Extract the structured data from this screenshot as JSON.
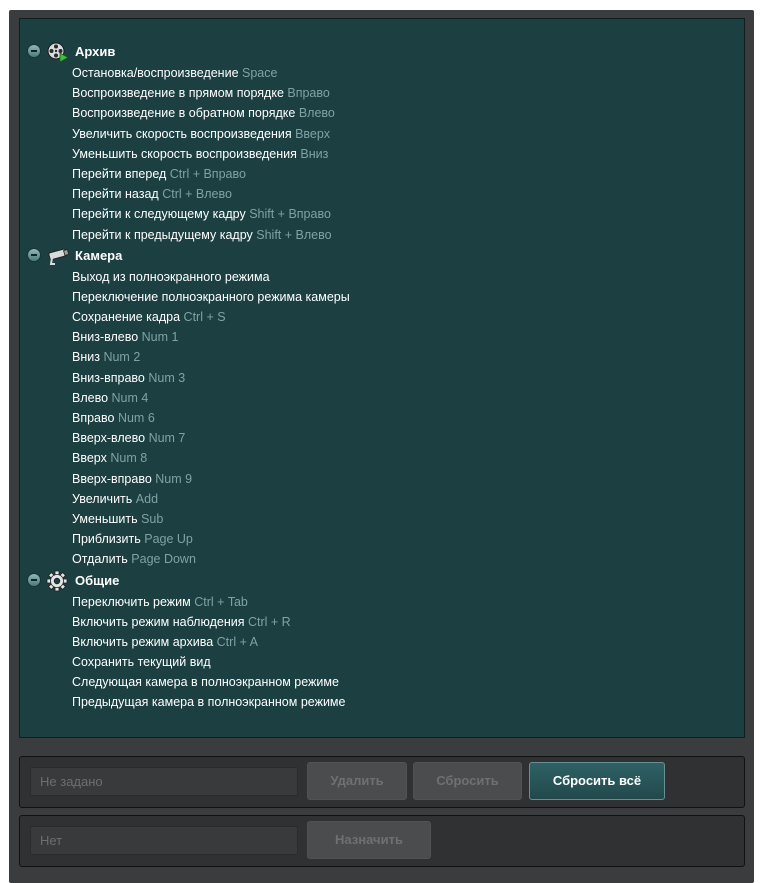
{
  "tree": {
    "groups": [
      {
        "title": "Архив",
        "icon": "film-reel-play-icon",
        "items": [
          {
            "label": "Остановка/воспроизведение",
            "key": "Space"
          },
          {
            "label": "Воспроизведение в прямом порядке",
            "key": "Вправо"
          },
          {
            "label": "Воспроизведение в обратном порядке",
            "key": "Влево"
          },
          {
            "label": "Увеличить скорость воспроизведения",
            "key": "Вверх"
          },
          {
            "label": "Уменьшить скорость воспроизведения",
            "key": "Вниз"
          },
          {
            "label": "Перейти вперед",
            "key": "Ctrl + Вправо"
          },
          {
            "label": "Перейти назад",
            "key": "Ctrl + Влево"
          },
          {
            "label": "Перейти к следующему кадру",
            "key": "Shift + Вправо"
          },
          {
            "label": "Перейти к предыдущему кадру",
            "key": "Shift + Влево"
          }
        ]
      },
      {
        "title": "Камера",
        "icon": "camera-icon",
        "items": [
          {
            "label": "Выход из полноэкранного режима",
            "key": ""
          },
          {
            "label": "Переключение полноэкранного режима камеры",
            "key": ""
          },
          {
            "label": "Сохранение кадра",
            "key": "Ctrl + S"
          },
          {
            "label": "Вниз-влево",
            "key": "Num 1"
          },
          {
            "label": "Вниз",
            "key": "Num 2"
          },
          {
            "label": "Вниз-вправо",
            "key": "Num 3"
          },
          {
            "label": "Влево",
            "key": "Num 4"
          },
          {
            "label": "Вправо",
            "key": "Num 6"
          },
          {
            "label": "Вверх-влево",
            "key": "Num 7"
          },
          {
            "label": "Вверх",
            "key": "Num 8"
          },
          {
            "label": "Вверх-вправо",
            "key": "Num 9"
          },
          {
            "label": "Увеличить",
            "key": "Add"
          },
          {
            "label": "Уменьшить",
            "key": "Sub"
          },
          {
            "label": "Приблизить",
            "key": "Page Up"
          },
          {
            "label": "Отдалить",
            "key": "Page Down"
          }
        ]
      },
      {
        "title": "Общие",
        "icon": "gear-icon",
        "items": [
          {
            "label": "Переключить режим",
            "key": "Ctrl + Tab"
          },
          {
            "label": "Включить режим наблюдения",
            "key": "Ctrl + R"
          },
          {
            "label": "Включить режим архива",
            "key": "Ctrl + A"
          },
          {
            "label": "Сохранить текущий вид",
            "key": ""
          },
          {
            "label": "Следующая камера в полноэкранном режиме",
            "key": ""
          },
          {
            "label": "Предыдущая камера в полноэкранном режиме",
            "key": ""
          }
        ]
      }
    ]
  },
  "shortcut_panel": {
    "field_value": "Не задано",
    "delete_label": "Удалить",
    "reset_label": "Сбросить",
    "reset_all_label": "Сбросить всё"
  },
  "assign_panel": {
    "field_value": "Нет",
    "assign_label": "Назначить"
  },
  "colors": {
    "tree_background": "#1c3f41",
    "key_text": "#7fa3a5",
    "primary_button": "#2e6165"
  }
}
